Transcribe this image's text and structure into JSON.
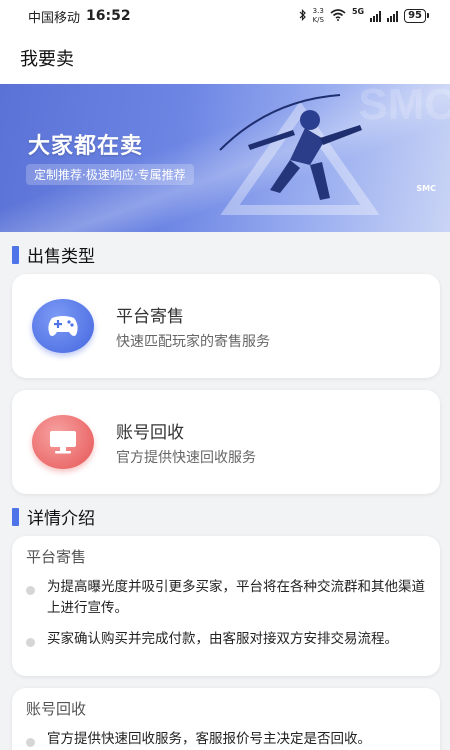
{
  "status_bar": {
    "carrier": "中国移动",
    "time": "16:52",
    "speed_value": "3.3",
    "speed_unit": "K/S",
    "network": "5G",
    "battery": "95",
    "icons": [
      "bluetooth-icon",
      "wifi-icon",
      "signal-icon",
      "battery-icon"
    ]
  },
  "header": {
    "title": "我要卖"
  },
  "banner": {
    "title": "大家都在卖",
    "tags": "定制推荐·极速响应·专属推荐",
    "brand": "SMC",
    "brand_big": "SMC"
  },
  "sections": {
    "sale_type": "出售类型",
    "details": "详情介绍"
  },
  "sale_types": [
    {
      "title": "平台寄售",
      "desc": "快速匹配玩家的寄售服务",
      "icon": "gamepad-icon",
      "color": "#4f73e8"
    },
    {
      "title": "账号回收",
      "desc": "官方提供快速回收服务",
      "icon": "monitor-icon",
      "color": "#e65555"
    }
  ],
  "detail_cards": [
    {
      "title": "平台寄售",
      "items": [
        "为提高曝光度并吸引更多买家，平台将在各种交流群和其他渠道上进行宣传。",
        "买家确认购买并完成付款，由客服对接双方安排交易流程。"
      ]
    },
    {
      "title": "账号回收",
      "items": [
        "官方提供快速回收服务，客服报价号主决定是否回收。"
      ]
    }
  ],
  "colors": {
    "accent": "#4f73e8",
    "red": "#e65555",
    "background": "#f2f3f5"
  }
}
